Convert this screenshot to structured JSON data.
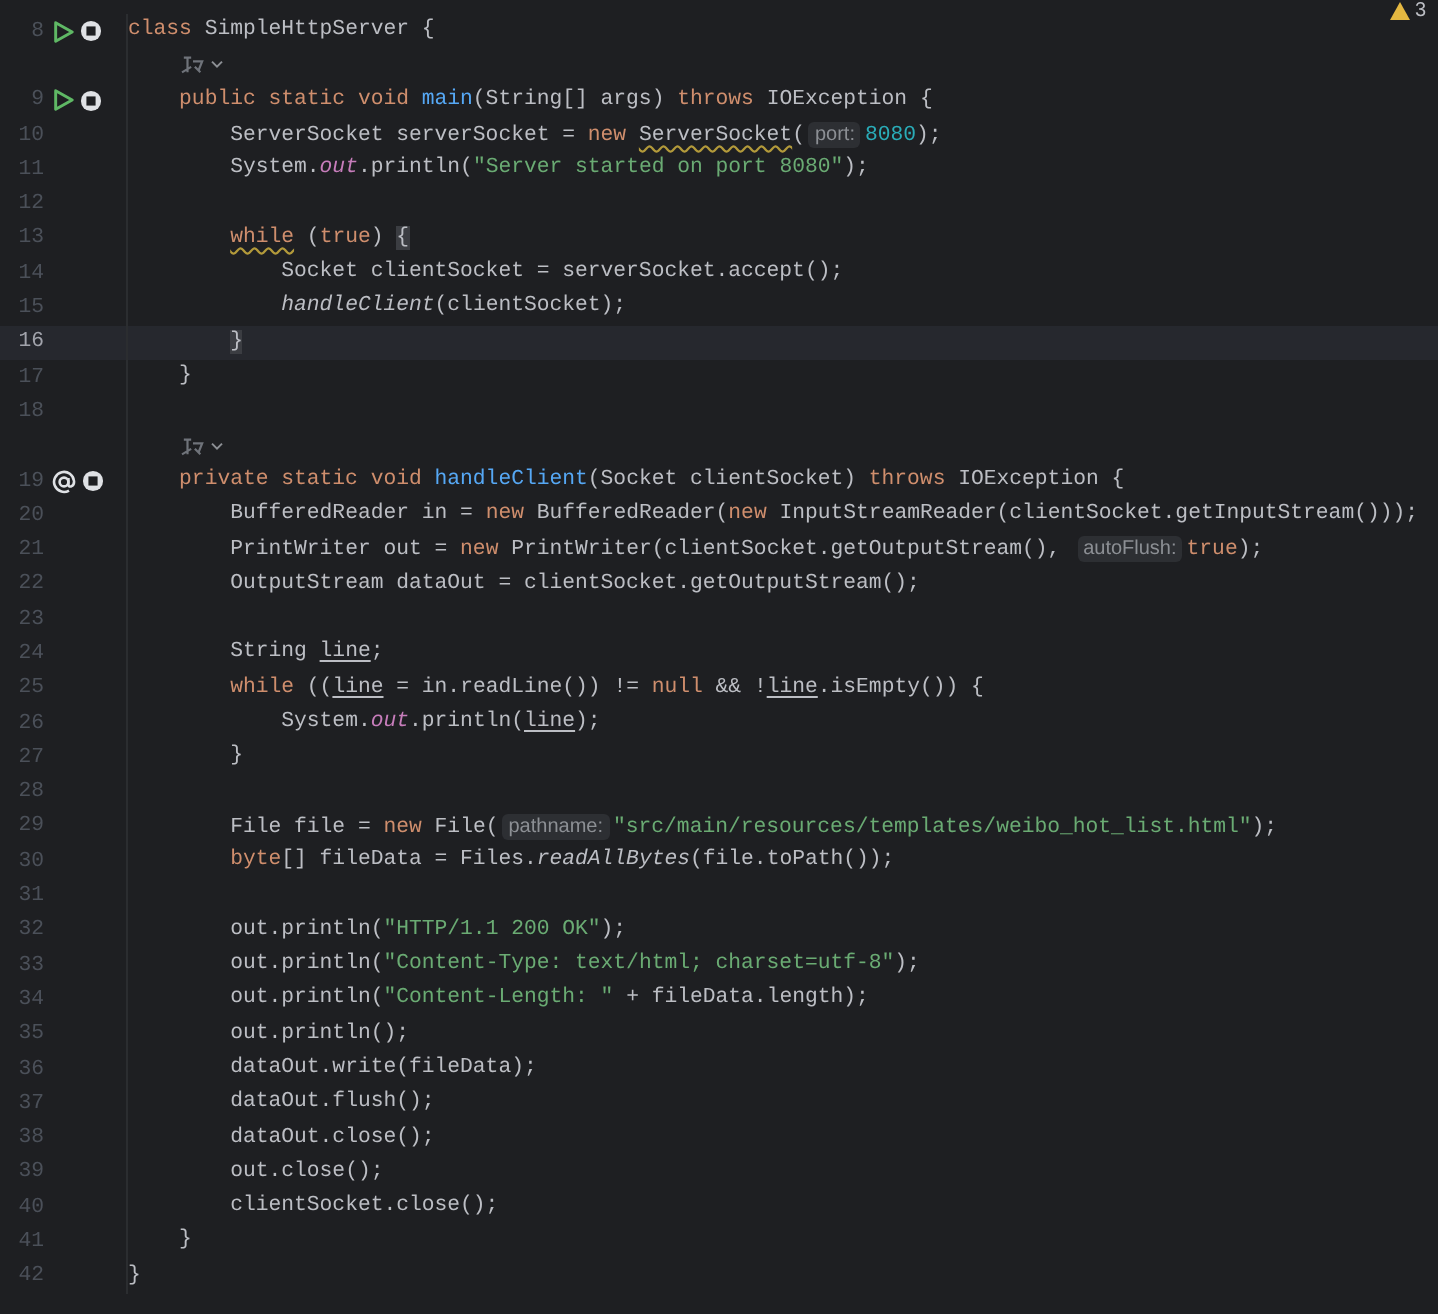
{
  "editor": {
    "problems_badge": {
      "count": "3"
    },
    "rows": [
      {
        "kind": "code",
        "number": "8",
        "current": false,
        "gutter": [
          {
            "kind": "run"
          },
          {
            "kind": "stop"
          }
        ],
        "tokens": [
          {
            "kind": "keyword",
            "t": "class "
          },
          {
            "kind": "plain",
            "t": "SimpleHttpServer {"
          }
        ]
      },
      {
        "kind": "hint"
      },
      {
        "kind": "code",
        "number": "9",
        "current": false,
        "gutter": [
          {
            "kind": "run"
          },
          {
            "kind": "stop"
          }
        ],
        "tokens": [
          {
            "kind": "keyword",
            "t": "    public static void "
          },
          {
            "kind": "decl",
            "t": "main"
          },
          {
            "kind": "plain",
            "t": "(String[] args) "
          },
          {
            "kind": "keyword",
            "t": "throws"
          },
          {
            "kind": "plain",
            "t": " IOException {"
          }
        ]
      },
      {
        "kind": "code",
        "number": "10",
        "current": false,
        "gutter": [],
        "tokens": [
          {
            "kind": "plain",
            "t": "        ServerSocket serverSocket = "
          },
          {
            "kind": "keyword",
            "t": "new "
          },
          {
            "kind": "warn",
            "t": "ServerSocket"
          },
          {
            "kind": "plain",
            "t": "("
          },
          {
            "kind": "inlay",
            "t": "port:"
          },
          {
            "kind": "number",
            "t": "8080"
          },
          {
            "kind": "plain",
            "t": ");"
          }
        ]
      },
      {
        "kind": "code",
        "number": "11",
        "current": false,
        "gutter": [],
        "tokens": [
          {
            "kind": "plain",
            "t": "        System."
          },
          {
            "kind": "field",
            "t": "out"
          },
          {
            "kind": "plain",
            "t": ".println("
          },
          {
            "kind": "string",
            "t": "\"Server started on port 8080\""
          },
          {
            "kind": "plain",
            "t": ");"
          }
        ]
      },
      {
        "kind": "code",
        "number": "12",
        "current": false,
        "gutter": [],
        "tokens": []
      },
      {
        "kind": "code",
        "number": "13",
        "current": false,
        "gutter": [],
        "tokens": [
          {
            "kind": "keyword-warn",
            "t": "        while"
          },
          {
            "kind": "plain",
            "t": " ("
          },
          {
            "kind": "keyword",
            "t": "true"
          },
          {
            "kind": "plain",
            "t": ") "
          },
          {
            "kind": "brace",
            "t": "{"
          }
        ]
      },
      {
        "kind": "code",
        "number": "14",
        "current": false,
        "gutter": [],
        "tokens": [
          {
            "kind": "plain",
            "t": "            Socket clientSocket = serverSocket.accept();"
          }
        ]
      },
      {
        "kind": "code",
        "number": "15",
        "current": false,
        "gutter": [],
        "tokens": [
          {
            "kind": "italic",
            "t": "            handleClient"
          },
          {
            "kind": "plain",
            "t": "(clientSocket);"
          }
        ]
      },
      {
        "kind": "code",
        "number": "16",
        "current": true,
        "gutter": [],
        "tokens": [
          {
            "kind": "brace",
            "t": "        }"
          }
        ]
      },
      {
        "kind": "code",
        "number": "17",
        "current": false,
        "gutter": [],
        "tokens": [
          {
            "kind": "plain",
            "t": "    }"
          }
        ]
      },
      {
        "kind": "code",
        "number": "18",
        "current": false,
        "gutter": [],
        "tokens": []
      },
      {
        "kind": "hint"
      },
      {
        "kind": "code",
        "number": "19",
        "current": false,
        "gutter": [
          {
            "kind": "at"
          },
          {
            "kind": "stop"
          }
        ],
        "tokens": [
          {
            "kind": "keyword",
            "t": "    private static void "
          },
          {
            "kind": "decl",
            "t": "handleClient"
          },
          {
            "kind": "plain",
            "t": "(Socket clientSocket) "
          },
          {
            "kind": "keyword",
            "t": "throws"
          },
          {
            "kind": "plain",
            "t": " IOException {"
          }
        ]
      },
      {
        "kind": "code",
        "number": "20",
        "current": false,
        "gutter": [],
        "tokens": [
          {
            "kind": "plain",
            "t": "        BufferedReader in = "
          },
          {
            "kind": "keyword",
            "t": "new"
          },
          {
            "kind": "plain",
            "t": " BufferedReader("
          },
          {
            "kind": "keyword",
            "t": "new"
          },
          {
            "kind": "plain",
            "t": " InputStreamReader(clientSocket.getInputStream()));"
          }
        ]
      },
      {
        "kind": "code",
        "number": "21",
        "current": false,
        "gutter": [],
        "tokens": [
          {
            "kind": "plain",
            "t": "        PrintWriter out = "
          },
          {
            "kind": "keyword",
            "t": "new"
          },
          {
            "kind": "plain",
            "t": " PrintWriter(clientSocket.getOutputStream(), "
          },
          {
            "kind": "inlay",
            "t": "autoFlush:"
          },
          {
            "kind": "keyword",
            "t": "true"
          },
          {
            "kind": "plain",
            "t": ");"
          }
        ]
      },
      {
        "kind": "code",
        "number": "22",
        "current": false,
        "gutter": [],
        "tokens": [
          {
            "kind": "plain",
            "t": "        OutputStream dataOut = clientSocket.getOutputStream();"
          }
        ]
      },
      {
        "kind": "code",
        "number": "23",
        "current": false,
        "gutter": [],
        "tokens": []
      },
      {
        "kind": "code",
        "number": "24",
        "current": false,
        "gutter": [],
        "tokens": [
          {
            "kind": "plain",
            "t": "        String "
          },
          {
            "kind": "underline",
            "t": "line"
          },
          {
            "kind": "plain",
            "t": ";"
          }
        ]
      },
      {
        "kind": "code",
        "number": "25",
        "current": false,
        "gutter": [],
        "tokens": [
          {
            "kind": "keyword",
            "t": "        while"
          },
          {
            "kind": "plain",
            "t": " (("
          },
          {
            "kind": "underline",
            "t": "line"
          },
          {
            "kind": "plain",
            "t": " = in.readLine()) != "
          },
          {
            "kind": "keyword",
            "t": "null"
          },
          {
            "kind": "plain",
            "t": " && !"
          },
          {
            "kind": "underline",
            "t": "line"
          },
          {
            "kind": "plain",
            "t": ".isEmpty()) {"
          }
        ]
      },
      {
        "kind": "code",
        "number": "26",
        "current": false,
        "gutter": [],
        "tokens": [
          {
            "kind": "plain",
            "t": "            System."
          },
          {
            "kind": "field",
            "t": "out"
          },
          {
            "kind": "plain",
            "t": ".println("
          },
          {
            "kind": "underline",
            "t": "line"
          },
          {
            "kind": "plain",
            "t": ");"
          }
        ]
      },
      {
        "kind": "code",
        "number": "27",
        "current": false,
        "gutter": [],
        "tokens": [
          {
            "kind": "plain",
            "t": "        }"
          }
        ]
      },
      {
        "kind": "code",
        "number": "28",
        "current": false,
        "gutter": [],
        "tokens": []
      },
      {
        "kind": "code",
        "number": "29",
        "current": false,
        "gutter": [],
        "tokens": [
          {
            "kind": "plain",
            "t": "        File file = "
          },
          {
            "kind": "keyword",
            "t": "new"
          },
          {
            "kind": "plain",
            "t": " File("
          },
          {
            "kind": "inlay",
            "t": "pathname:"
          },
          {
            "kind": "string",
            "t": "\"src/main/resources/templates/weibo_hot_list.html\""
          },
          {
            "kind": "plain",
            "t": ");"
          }
        ]
      },
      {
        "kind": "code",
        "number": "30",
        "current": false,
        "gutter": [],
        "tokens": [
          {
            "kind": "keyword",
            "t": "        byte"
          },
          {
            "kind": "plain",
            "t": "[] fileData = Files."
          },
          {
            "kind": "italic",
            "t": "readAllBytes"
          },
          {
            "kind": "plain",
            "t": "(file.toPath());"
          }
        ]
      },
      {
        "kind": "code",
        "number": "31",
        "current": false,
        "gutter": [],
        "tokens": []
      },
      {
        "kind": "code",
        "number": "32",
        "current": false,
        "gutter": [],
        "tokens": [
          {
            "kind": "plain",
            "t": "        out.println("
          },
          {
            "kind": "string",
            "t": "\"HTTP/1.1 200 OK\""
          },
          {
            "kind": "plain",
            "t": ");"
          }
        ]
      },
      {
        "kind": "code",
        "number": "33",
        "current": false,
        "gutter": [],
        "tokens": [
          {
            "kind": "plain",
            "t": "        out.println("
          },
          {
            "kind": "string",
            "t": "\"Content-Type: text/html; charset=utf-8\""
          },
          {
            "kind": "plain",
            "t": ");"
          }
        ]
      },
      {
        "kind": "code",
        "number": "34",
        "current": false,
        "gutter": [],
        "tokens": [
          {
            "kind": "plain",
            "t": "        out.println("
          },
          {
            "kind": "string",
            "t": "\"Content-Length: \""
          },
          {
            "kind": "plain",
            "t": " + fileData.length);"
          }
        ]
      },
      {
        "kind": "code",
        "number": "35",
        "current": false,
        "gutter": [],
        "tokens": [
          {
            "kind": "plain",
            "t": "        out.println();"
          }
        ]
      },
      {
        "kind": "code",
        "number": "36",
        "current": false,
        "gutter": [],
        "tokens": [
          {
            "kind": "plain",
            "t": "        dataOut.write(fileData);"
          }
        ]
      },
      {
        "kind": "code",
        "number": "37",
        "current": false,
        "gutter": [],
        "tokens": [
          {
            "kind": "plain",
            "t": "        dataOut.flush();"
          }
        ]
      },
      {
        "kind": "code",
        "number": "38",
        "current": false,
        "gutter": [],
        "tokens": [
          {
            "kind": "plain",
            "t": "        dataOut.close();"
          }
        ]
      },
      {
        "kind": "code",
        "number": "39",
        "current": false,
        "gutter": [],
        "tokens": [
          {
            "kind": "plain",
            "t": "        out.close();"
          }
        ]
      },
      {
        "kind": "code",
        "number": "40",
        "current": false,
        "gutter": [],
        "tokens": [
          {
            "kind": "plain",
            "t": "        clientSocket.close();"
          }
        ]
      },
      {
        "kind": "code",
        "number": "41",
        "current": false,
        "gutter": [],
        "tokens": [
          {
            "kind": "plain",
            "t": "    }"
          }
        ]
      },
      {
        "kind": "code",
        "number": "42",
        "current": false,
        "gutter": [],
        "tokens": [
          {
            "kind": "plain",
            "t": "}"
          }
        ]
      }
    ]
  }
}
